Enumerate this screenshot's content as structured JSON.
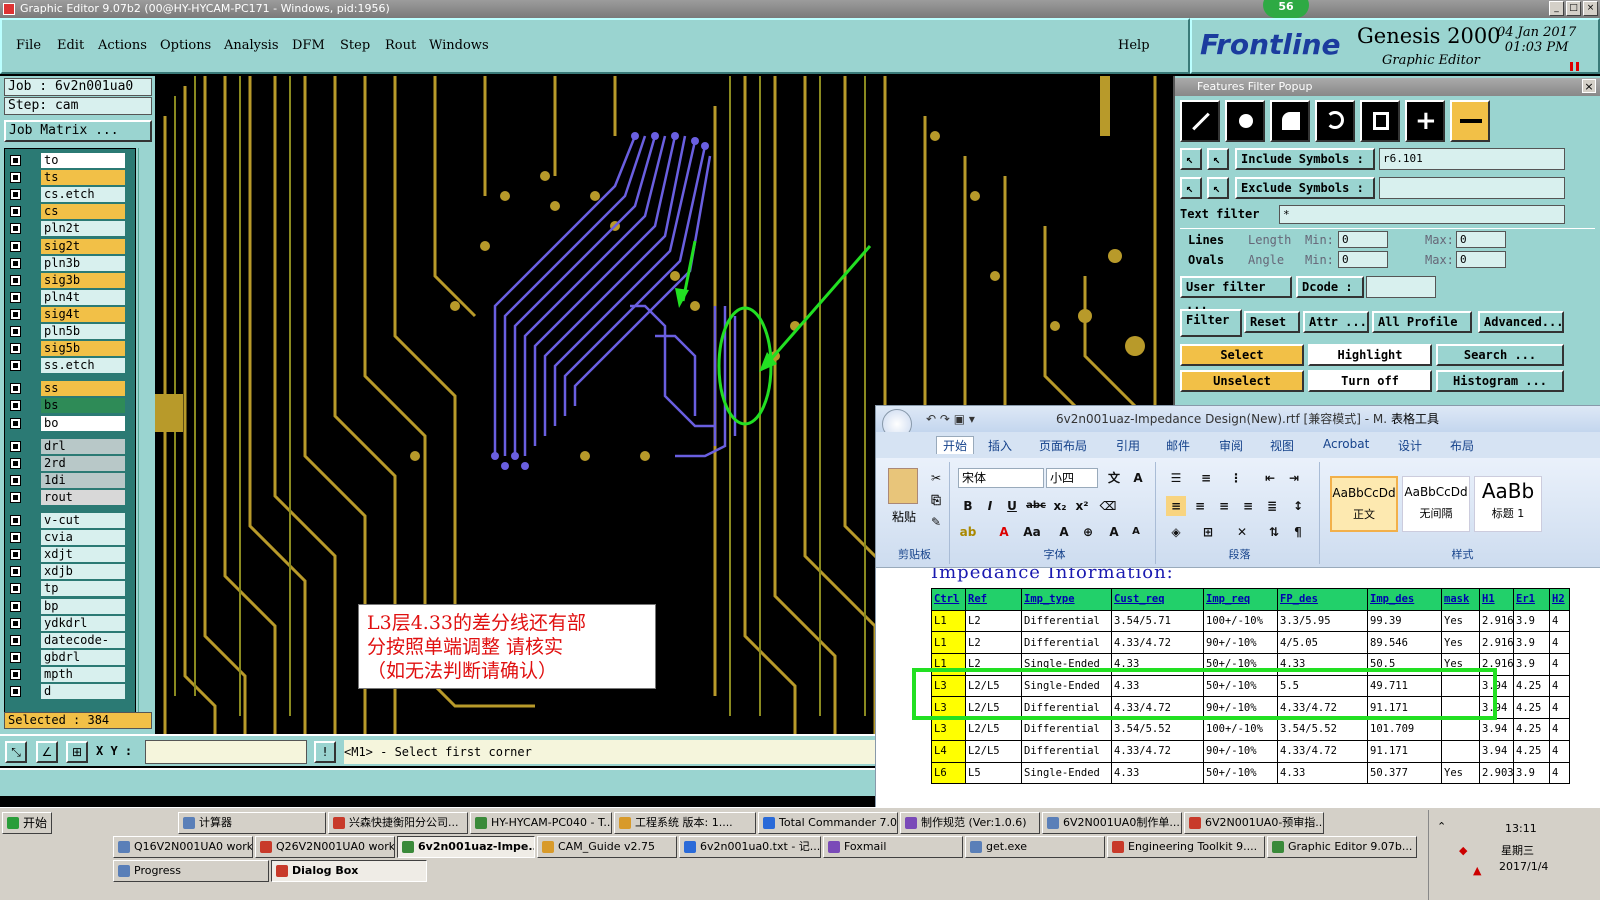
{
  "window": {
    "title": "Graphic Editor 9.07b2 (00@HY-HYCAM-PC171 - Windows, pid:1956)",
    "badge": "56"
  },
  "menu": [
    "File",
    "Edit",
    "Actions",
    "Options",
    "Analysis",
    "DFM",
    "Step",
    "Rout",
    "Windows"
  ],
  "help": "Help",
  "logo": {
    "brand": "Frontline",
    "product": "Genesis 2000",
    "subtitle": "Graphic Editor",
    "date": "04 Jan 2017",
    "time": "01:03 PM"
  },
  "left": {
    "job": "Job : 6v2n001ua0",
    "step": "Step: cam",
    "job_matrix": "Job Matrix ...",
    "selected": "Selected : 384"
  },
  "layers": [
    {
      "name": "to",
      "color": "#ffffff"
    },
    {
      "name": "ts",
      "color": "#f2c047"
    },
    {
      "name": "cs.etch",
      "color": "#d8f0ee"
    },
    {
      "name": "cs",
      "color": "#f2c047"
    },
    {
      "name": "pln2t",
      "color": "#d8f0ee"
    },
    {
      "name": "sig2t",
      "color": "#f2c047"
    },
    {
      "name": "pln3b",
      "color": "#d8f0ee"
    },
    {
      "name": "sig3b",
      "color": "#f2c047"
    },
    {
      "name": "pln4t",
      "color": "#d8f0ee"
    },
    {
      "name": "sig4t",
      "color": "#f2c047"
    },
    {
      "name": "pln5b",
      "color": "#d8f0ee"
    },
    {
      "name": "sig5b",
      "color": "#f2c047"
    },
    {
      "name": "ss.etch",
      "color": "#d8f0ee"
    },
    {
      "name": "ss",
      "color": "#f2c047"
    },
    {
      "name": "bs",
      "color": "#2e8b57"
    },
    {
      "name": "bo",
      "color": "#ffffff"
    },
    {
      "name": "drl",
      "color": "#b8c8c8"
    },
    {
      "name": "2rd",
      "color": "#b8c8c8"
    },
    {
      "name": "1di",
      "color": "#b8c8c8"
    },
    {
      "name": "rout",
      "color": "#d8d8d8"
    },
    {
      "name": "v-cut",
      "color": "#d8f0ee"
    },
    {
      "name": "cvia",
      "color": "#d8f0ee"
    },
    {
      "name": "xdjt",
      "color": "#d8f0ee"
    },
    {
      "name": "xdjb",
      "color": "#d8f0ee"
    },
    {
      "name": "tp",
      "color": "#d8f0ee"
    },
    {
      "name": "bp",
      "color": "#d8f0ee"
    },
    {
      "name": "ydkdrl",
      "color": "#d8f0ee"
    },
    {
      "name": "datecode-pbe",
      "color": "#d8f0ee"
    },
    {
      "name": "gbdrl",
      "color": "#d8f0ee"
    },
    {
      "name": "mpth",
      "color": "#d8f0ee"
    },
    {
      "name": "d",
      "color": "#d8f0ee"
    }
  ],
  "status": {
    "xy_label": "X Y :",
    "message": "<M1> - Select first corner"
  },
  "filter": {
    "title": "Features Filter Popup",
    "include_label": "Include Symbols :",
    "include_value": "r6.101",
    "exclude_label": "Exclude Symbols :",
    "text_filter_label": "Text filter",
    "text_filter_value": "*",
    "lines": "Lines",
    "ovals": "Ovals",
    "length": "Length",
    "angle": "Angle",
    "min": "Min:",
    "max": "Max:",
    "zero": "0",
    "user_filter": "User filter ...",
    "dcode": "Dcode :",
    "filter_btn": "Filter",
    "reset": "Reset",
    "attr": "Attr ...",
    "all_profile": "All Profile",
    "advanced": "Advanced...",
    "select": "Select",
    "highlight": "Highlight",
    "search": "Search ...",
    "unselect": "Unselect",
    "turn_off": "Turn off",
    "histogram": "Histogram ..."
  },
  "word": {
    "title": "6v2n001uaz-Impedance Design(New).rtf [兼容模式] - M.",
    "context_tab": "表格工具",
    "tabs": [
      "开始",
      "插入",
      "页面布局",
      "引用",
      "邮件",
      "审阅",
      "视图",
      "Acrobat",
      "设计",
      "布局"
    ],
    "font": "宋体",
    "size": "小四",
    "groups": {
      "clipboard": "剪贴板",
      "font": "字体",
      "paragraph": "段落",
      "styles": "样式"
    },
    "paste": "粘贴",
    "styles": [
      {
        "sample": "AaBbCcDd",
        "name": "正文"
      },
      {
        "sample": "AaBbCcDd",
        "name": "无间隔"
      },
      {
        "sample": "AaBb",
        "name": "标题 1"
      }
    ],
    "doc_title": "Impedance Information:",
    "table_header": [
      "Ctrl",
      "Ref",
      "Imp_type",
      "Cust_req",
      "Imp_req",
      "FP_des",
      "Imp_des",
      "mask",
      "H1",
      "Er1",
      "H2"
    ],
    "rows": [
      [
        "L1",
        "L2",
        "Differential",
        "3.54/5.71",
        "100+/-10%",
        "3.3/5.95",
        "99.39",
        "Yes",
        "2.916",
        "3.9",
        "4"
      ],
      [
        "L1",
        "L2",
        "Differential",
        "4.33/4.72",
        "90+/-10%",
        "4/5.05",
        "89.546",
        "Yes",
        "2.916",
        "3.9",
        "4"
      ],
      [
        "L1",
        "L2",
        "Single-Ended",
        "4.33",
        "50+/-10%",
        "4.33",
        "50.5",
        "Yes",
        "2.916",
        "3.9",
        "4"
      ],
      [
        "L3",
        "L2/L5",
        "Single-Ended",
        "4.33",
        "50+/-10%",
        "5.5",
        "49.711",
        "",
        "3.94",
        "4.25",
        "4"
      ],
      [
        "L3",
        "L2/L5",
        "Differential",
        "4.33/4.72",
        "90+/-10%",
        "4.33/4.72",
        "91.171",
        "",
        "3.94",
        "4.25",
        "4"
      ],
      [
        "L3",
        "L2/L5",
        "Differential",
        "3.54/5.52",
        "100+/-10%",
        "3.54/5.52",
        "101.709",
        "",
        "3.94",
        "4.25",
        "4"
      ],
      [
        "L4",
        "L2/L5",
        "Differential",
        "4.33/4.72",
        "90+/-10%",
        "4.33/4.72",
        "91.171",
        "",
        "3.94",
        "4.25",
        "4"
      ],
      [
        "L6",
        "L5",
        "Single-Ended",
        "4.33",
        "50+/-10%",
        "4.33",
        "50.377",
        "Yes",
        "2.903",
        "3.9",
        "4"
      ]
    ]
  },
  "note": {
    "line1": "L3层4.33的差分线还有部",
    "line2": "分按照单端调整  请核实",
    "line3": "（如无法判断请确认）"
  },
  "taskbar": {
    "start": "开始",
    "row1": [
      "计算器",
      "兴森快捷衡阳分公司...",
      "HY-HYCAM-PC040 - T...",
      "工程系统  版本: 1....",
      "Total Commander 7.0 ...",
      "制作规范 (Ver:1.0.6)",
      "6V2N001UA0制作单....",
      "6V2N001UA0-预审指..."
    ],
    "row2": [
      "Q16V2N001UA0 work...",
      "Q26V2N001UA0 work...",
      "6v2n001uaz-Impe...",
      "CAM_Guide v2.75",
      "6v2n001ua0.txt - 记...",
      "Foxmail",
      "get.exe",
      "Engineering Toolkit 9....",
      "Graphic Editor 9.07b..."
    ],
    "row3": [
      "Progress",
      "Dialog Box"
    ],
    "clock": "13:11",
    "weekday": "星期三",
    "date": "2017/1/4"
  }
}
